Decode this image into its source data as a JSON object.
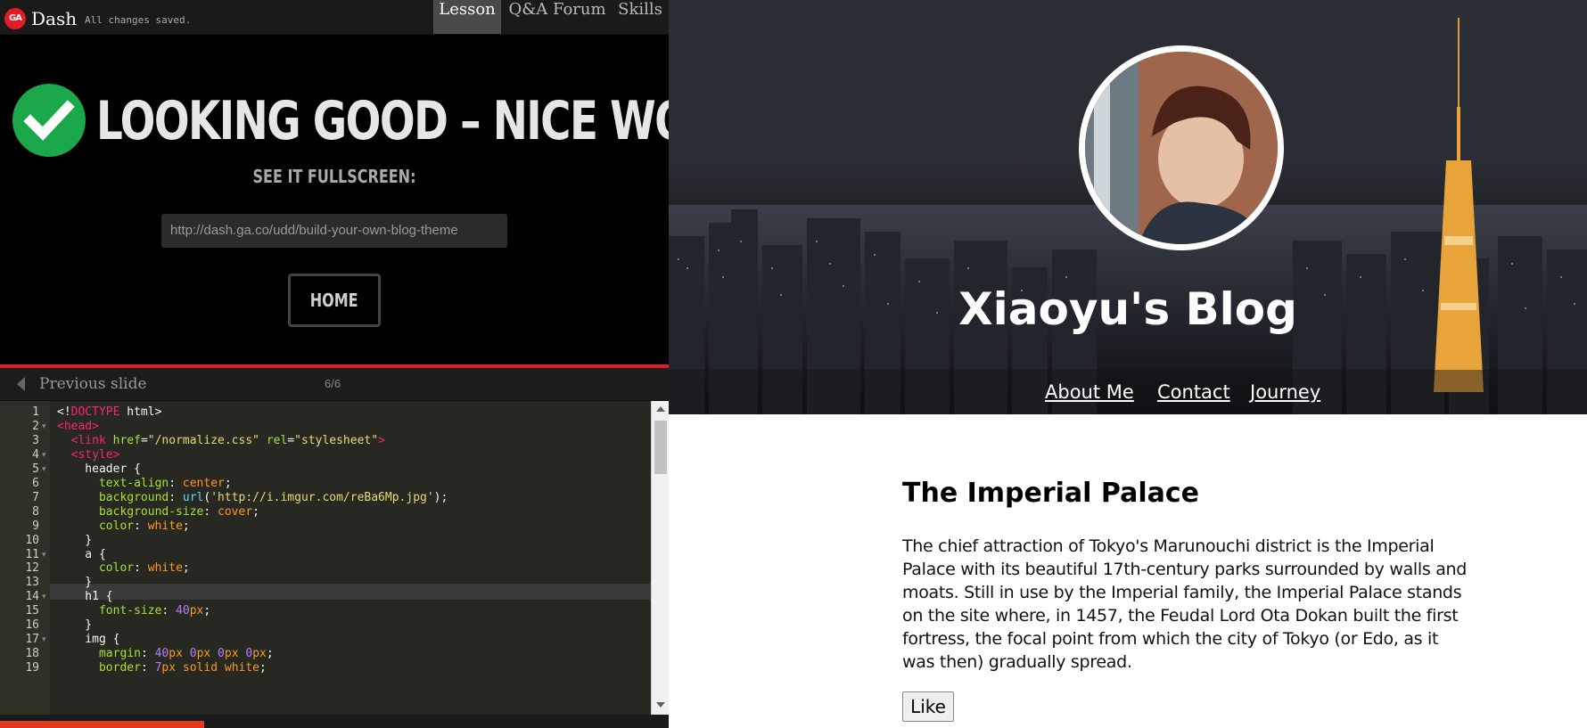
{
  "app": {
    "logo_text": "GA",
    "name": "Dash",
    "save_status": "All changes saved.",
    "tabs": [
      {
        "label": "Lesson",
        "active": true
      },
      {
        "label": "Q&A Forum",
        "active": false
      },
      {
        "label": "Skills",
        "active": false
      }
    ]
  },
  "success": {
    "headline": "LOOKING GOOD – NICE WORK!",
    "subheading": "SEE IT FULLSCREEN:",
    "url": "http://dash.ga.co/udd/build-your-own-blog-theme",
    "home_label": "HOME"
  },
  "slide_nav": {
    "prev_label": "Previous slide",
    "counter": "6/6"
  },
  "editor": {
    "line_numbers": [
      "1",
      "2",
      "3",
      "4",
      "5",
      "6",
      "7",
      "8",
      "9",
      "10",
      "11",
      "12",
      "13",
      "14",
      "15",
      "16",
      "17",
      "18",
      "19"
    ]
  },
  "colors": {
    "accent_red": "#e31b23",
    "success_green": "#1aa84a",
    "progress_orange": "#e33a1f"
  },
  "blog": {
    "title": "Xiaoyu's Blog",
    "nav": [
      "About Me",
      "Contact",
      "Journey"
    ],
    "post_title": "The Imperial Palace",
    "post_body": "The chief attraction of Tokyo's Marunouchi district is the Imperial Palace with its beautiful 17th-century parks surrounded by walls and moats. Still in use by the Imperial family, the Imperial Palace stands on the site where, in 1457, the Feudal Lord Ota Dokan built the first fortress, the focal point from which the city of Tokyo (or Edo, as it was then) gradually spread.",
    "like_label": "Like"
  }
}
